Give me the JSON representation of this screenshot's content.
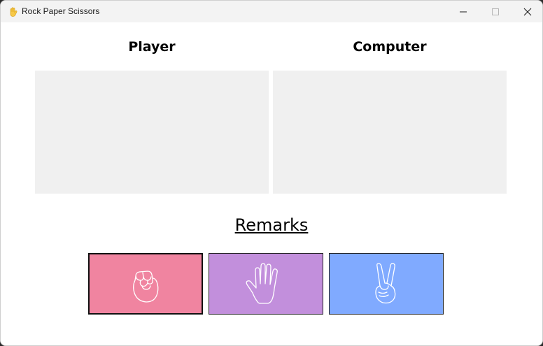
{
  "window": {
    "title": "Rock Paper Scissors",
    "controls": {
      "minimize": "minimize",
      "maximize": "maximize",
      "close": "close"
    }
  },
  "columns": {
    "player": "Player",
    "computer": "Computer"
  },
  "remarks": "Remarks",
  "choices": [
    {
      "id": "rock",
      "icon": "fist-icon",
      "color": "#f084a0",
      "selected": true
    },
    {
      "id": "paper",
      "icon": "open-hand-icon",
      "color": "#c28fdc",
      "selected": false
    },
    {
      "id": "scissors",
      "icon": "peace-hand-icon",
      "color": "#80aaff",
      "selected": false
    }
  ]
}
